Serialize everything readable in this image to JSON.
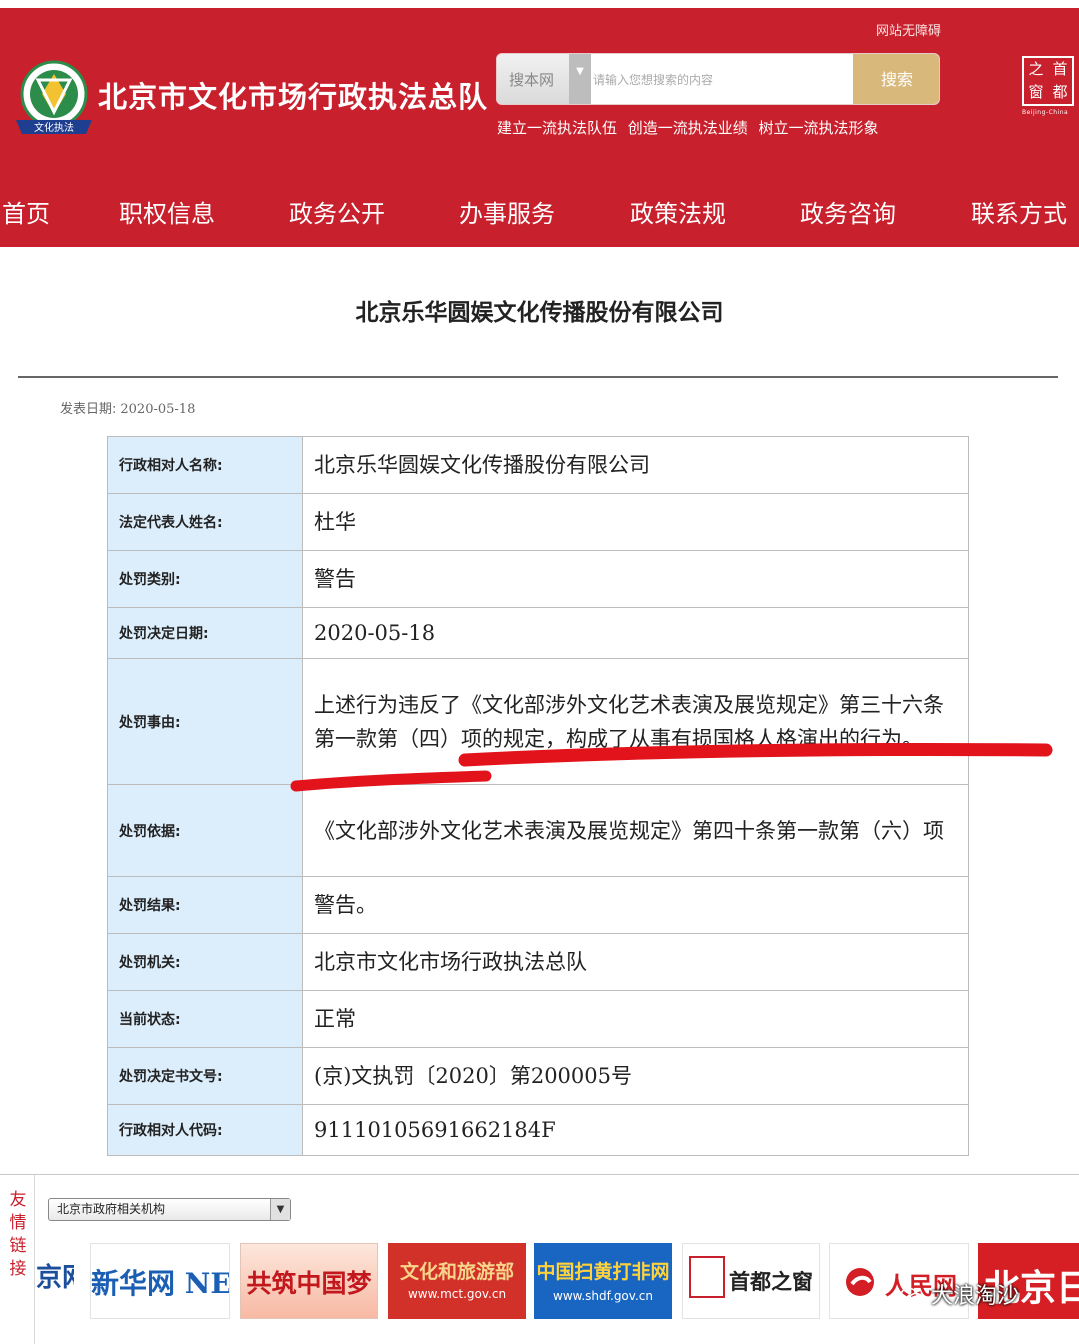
{
  "header": {
    "accessibility_label": "网站无障碍",
    "site_title": "北京市文化市场行政执法总队",
    "search": {
      "scope": "搜本网",
      "placeholder": "请输入您想搜索的内容",
      "button": "搜索"
    },
    "slogan": "建立一流执法队伍 创造一流执法业绩 树立一流执法形象",
    "capital_logo": {
      "chars": [
        "之",
        "首",
        "窗",
        "都"
      ],
      "sub": "Beijing-China"
    }
  },
  "nav": {
    "items": [
      "首页",
      "职权信息",
      "政务公开",
      "办事服务",
      "政策法规",
      "政务咨询",
      "联系方式"
    ]
  },
  "article": {
    "title": "北京乐华圆娱文化传播股份有限公司",
    "date_label": "发表日期:",
    "date": "2020-05-18",
    "rows": [
      {
        "label": "行政相对人名称:",
        "value": "北京乐华圆娱文化传播股份有限公司"
      },
      {
        "label": "法定代表人姓名:",
        "value": "杜华"
      },
      {
        "label": "处罚类别:",
        "value": "警告"
      },
      {
        "label": "处罚决定日期:",
        "value": "2020-05-18"
      },
      {
        "label": "处罚事由:",
        "value": "上述行为违反了《文化部涉外文化艺术表演及展览规定》第三十六条第一款第（四）项的规定，构成了从事有损国格人格演出的行为。"
      },
      {
        "label": "处罚依据:",
        "value": "《文化部涉外文化艺术表演及展览规定》第四十条第一款第（六）项"
      },
      {
        "label": "处罚结果:",
        "value": "警告。"
      },
      {
        "label": "处罚机关:",
        "value": "北京市文化市场行政执法总队"
      },
      {
        "label": "当前状态:",
        "value": "正常"
      },
      {
        "label": "处罚决定书文号:",
        "value": "(京)文执罚〔2020〕第200005号"
      },
      {
        "label": "行政相对人代码:",
        "value": "91110105691662184F"
      }
    ]
  },
  "footer": {
    "friend_links_label": "友情链接",
    "gov_select": "北京市政府相关机构",
    "banners": [
      {
        "name": "partial-site-link",
        "text": "京网"
      },
      {
        "name": "xinhua-link",
        "text": "新华网 NEWS"
      },
      {
        "name": "chinese-dream-link",
        "text": "共筑中国梦"
      },
      {
        "name": "mct-link",
        "text": "文化和旅游部",
        "sub": "www.mct.gov.cn"
      },
      {
        "name": "shdf-link",
        "text": "中国扫黄打非网",
        "sub": "www.shdf.gov.cn"
      },
      {
        "name": "capital-window-link",
        "text": "首都之窗"
      },
      {
        "name": "people-link",
        "text": "人民网"
      },
      {
        "name": "beijing-daily-link",
        "text": "北京日"
      }
    ],
    "watermark": "大浪淘沙"
  }
}
